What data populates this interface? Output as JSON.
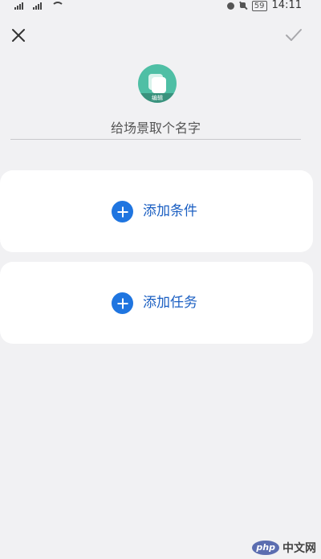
{
  "status_bar": {
    "time": "14:11",
    "battery": "59"
  },
  "toolbar": {
    "close_icon": "close-icon",
    "confirm_icon": "checkmark-icon"
  },
  "scene": {
    "avatar_icon": "scene-cards-icon",
    "avatar_accent": "#4fbfa5",
    "avatar_caption": "编辑",
    "name_placeholder": "给场景取个名字",
    "name_value": ""
  },
  "cards": {
    "condition": {
      "label": "添加条件",
      "icon": "plus-circle-icon"
    },
    "task": {
      "label": "添加任务",
      "icon": "plus-circle-icon"
    },
    "accent": "#1f75e0"
  },
  "watermark": {
    "badge": "php",
    "text": "中文网"
  }
}
